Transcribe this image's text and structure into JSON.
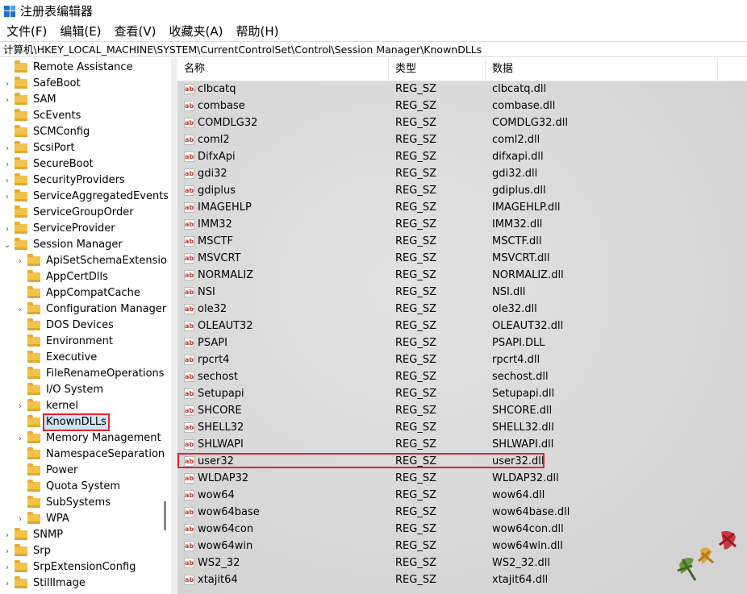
{
  "window": {
    "title": "注册表编辑器"
  },
  "menu": [
    "文件(F)",
    "编辑(E)",
    "查看(V)",
    "收藏夹(A)",
    "帮助(H)"
  ],
  "address": "计算机\\HKEY_LOCAL_MACHINE\\SYSTEM\\CurrentControlSet\\Control\\Session Manager\\KnownDLLs",
  "tree": [
    {
      "label": "Remote Assistance",
      "depth": 0,
      "expander": "none"
    },
    {
      "label": "SafeBoot",
      "depth": 0,
      "expander": "collapsed"
    },
    {
      "label": "SAM",
      "depth": 0,
      "expander": "collapsed"
    },
    {
      "label": "ScEvents",
      "depth": 0,
      "expander": "none"
    },
    {
      "label": "SCMConfig",
      "depth": 0,
      "expander": "none"
    },
    {
      "label": "ScsiPort",
      "depth": 0,
      "expander": "collapsed"
    },
    {
      "label": "SecureBoot",
      "depth": 0,
      "expander": "collapsed"
    },
    {
      "label": "SecurityProviders",
      "depth": 0,
      "expander": "collapsed"
    },
    {
      "label": "ServiceAggregatedEvents",
      "depth": 0,
      "expander": "collapsed"
    },
    {
      "label": "ServiceGroupOrder",
      "depth": 0,
      "expander": "none"
    },
    {
      "label": "ServiceProvider",
      "depth": 0,
      "expander": "collapsed"
    },
    {
      "label": "Session Manager",
      "depth": 0,
      "expander": "expanded"
    },
    {
      "label": "ApiSetSchemaExtensions",
      "depth": 1,
      "expander": "collapsed"
    },
    {
      "label": "AppCertDlls",
      "depth": 1,
      "expander": "none"
    },
    {
      "label": "AppCompatCache",
      "depth": 1,
      "expander": "none"
    },
    {
      "label": "Configuration Manager",
      "depth": 1,
      "expander": "collapsed"
    },
    {
      "label": "DOS Devices",
      "depth": 1,
      "expander": "none"
    },
    {
      "label": "Environment",
      "depth": 1,
      "expander": "none"
    },
    {
      "label": "Executive",
      "depth": 1,
      "expander": "none"
    },
    {
      "label": "FileRenameOperations",
      "depth": 1,
      "expander": "none"
    },
    {
      "label": "I/O System",
      "depth": 1,
      "expander": "none"
    },
    {
      "label": "kernel",
      "depth": 1,
      "expander": "collapsed"
    },
    {
      "label": "KnownDLLs",
      "depth": 1,
      "expander": "none",
      "selected": true
    },
    {
      "label": "Memory Management",
      "depth": 1,
      "expander": "collapsed"
    },
    {
      "label": "NamespaceSeparation",
      "depth": 1,
      "expander": "none"
    },
    {
      "label": "Power",
      "depth": 1,
      "expander": "none"
    },
    {
      "label": "Quota System",
      "depth": 1,
      "expander": "none"
    },
    {
      "label": "SubSystems",
      "depth": 1,
      "expander": "none"
    },
    {
      "label": "WPA",
      "depth": 1,
      "expander": "collapsed"
    },
    {
      "label": "SNMP",
      "depth": 0,
      "expander": "collapsed"
    },
    {
      "label": "Srp",
      "depth": 0,
      "expander": "collapsed"
    },
    {
      "label": "SrpExtensionConfig",
      "depth": 0,
      "expander": "collapsed"
    },
    {
      "label": "StillImage",
      "depth": 0,
      "expander": "collapsed"
    }
  ],
  "columns": {
    "name": "名称",
    "type": "类型",
    "data": "数据"
  },
  "value_icon_text": "ab",
  "values": [
    {
      "name": "clbcatq",
      "type": "REG_SZ",
      "data": "clbcatq.dll"
    },
    {
      "name": "combase",
      "type": "REG_SZ",
      "data": "combase.dll"
    },
    {
      "name": "COMDLG32",
      "type": "REG_SZ",
      "data": "COMDLG32.dll"
    },
    {
      "name": "coml2",
      "type": "REG_SZ",
      "data": "coml2.dll"
    },
    {
      "name": "DifxApi",
      "type": "REG_SZ",
      "data": "difxapi.dll"
    },
    {
      "name": "gdi32",
      "type": "REG_SZ",
      "data": "gdi32.dll"
    },
    {
      "name": "gdiplus",
      "type": "REG_SZ",
      "data": "gdiplus.dll"
    },
    {
      "name": "IMAGEHLP",
      "type": "REG_SZ",
      "data": "IMAGEHLP.dll"
    },
    {
      "name": "IMM32",
      "type": "REG_SZ",
      "data": "IMM32.dll"
    },
    {
      "name": "MSCTF",
      "type": "REG_SZ",
      "data": "MSCTF.dll"
    },
    {
      "name": "MSVCRT",
      "type": "REG_SZ",
      "data": "MSVCRT.dll"
    },
    {
      "name": "NORMALIZ",
      "type": "REG_SZ",
      "data": "NORMALIZ.dll"
    },
    {
      "name": "NSI",
      "type": "REG_SZ",
      "data": "NSI.dll"
    },
    {
      "name": "ole32",
      "type": "REG_SZ",
      "data": "ole32.dll"
    },
    {
      "name": "OLEAUT32",
      "type": "REG_SZ",
      "data": "OLEAUT32.dll"
    },
    {
      "name": "PSAPI",
      "type": "REG_SZ",
      "data": "PSAPI.DLL"
    },
    {
      "name": "rpcrt4",
      "type": "REG_SZ",
      "data": "rpcrt4.dll"
    },
    {
      "name": "sechost",
      "type": "REG_SZ",
      "data": "sechost.dll"
    },
    {
      "name": "Setupapi",
      "type": "REG_SZ",
      "data": "Setupapi.dll"
    },
    {
      "name": "SHCORE",
      "type": "REG_SZ",
      "data": "SHCORE.dll"
    },
    {
      "name": "SHELL32",
      "type": "REG_SZ",
      "data": "SHELL32.dll"
    },
    {
      "name": "SHLWAPI",
      "type": "REG_SZ",
      "data": "SHLWAPI.dll"
    },
    {
      "name": "user32",
      "type": "REG_SZ",
      "data": "user32.dll",
      "highlighted": true
    },
    {
      "name": "WLDAP32",
      "type": "REG_SZ",
      "data": "WLDAP32.dll"
    },
    {
      "name": "wow64",
      "type": "REG_SZ",
      "data": "wow64.dll"
    },
    {
      "name": "wow64base",
      "type": "REG_SZ",
      "data": "wow64base.dll"
    },
    {
      "name": "wow64con",
      "type": "REG_SZ",
      "data": "wow64con.dll"
    },
    {
      "name": "wow64win",
      "type": "REG_SZ",
      "data": "wow64win.dll"
    },
    {
      "name": "WS2_32",
      "type": "REG_SZ",
      "data": "WS2_32.dll"
    },
    {
      "name": "xtajit64",
      "type": "REG_SZ",
      "data": "xtajit64.dll"
    }
  ],
  "colors": {
    "highlight_border": "#e0242c",
    "folder": "#f3c24b",
    "selection": "#cce4f7"
  }
}
